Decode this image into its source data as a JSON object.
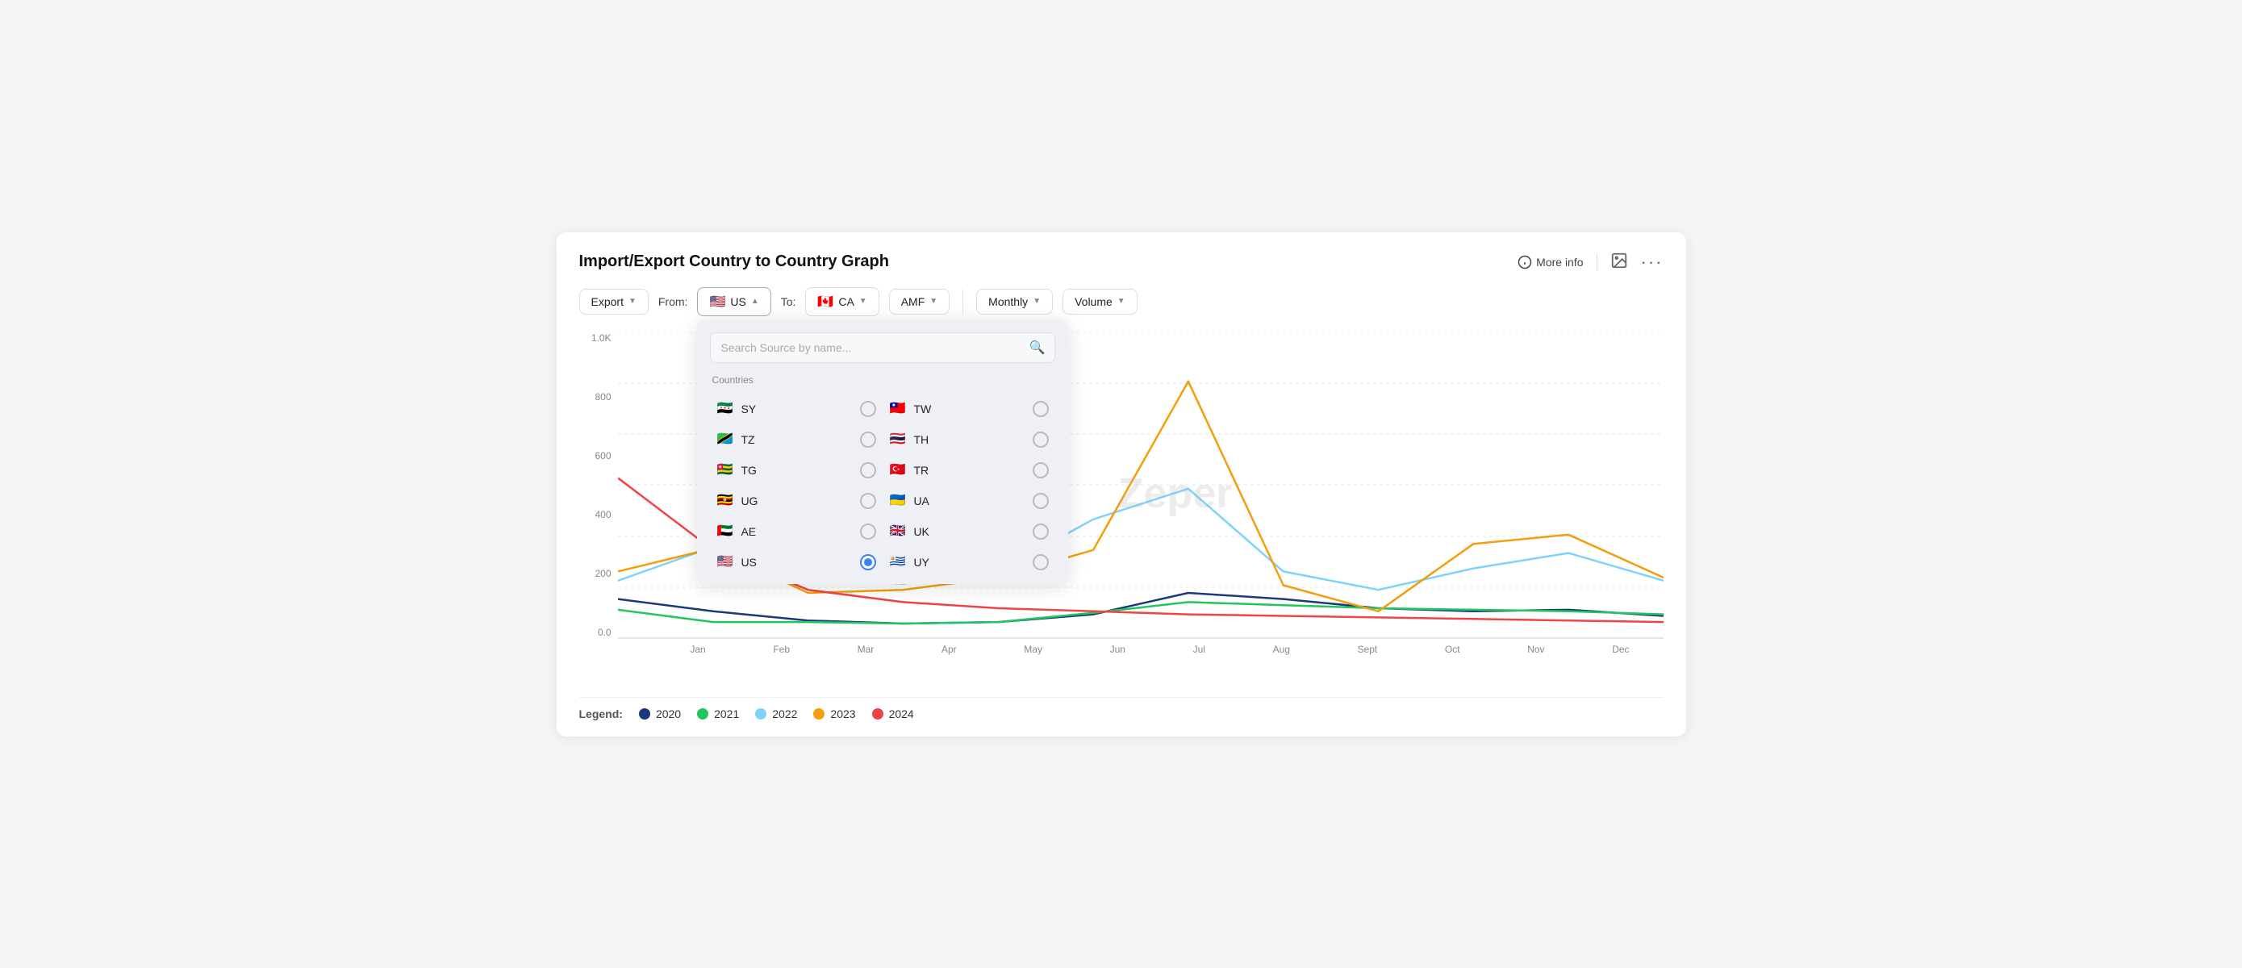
{
  "title": "Import/Export Country to Country Graph",
  "header_actions": {
    "more_info": "More info",
    "image_icon": "image-icon",
    "dots_icon": "more-options-icon"
  },
  "controls": {
    "export_label": "Export",
    "from_label": "From:",
    "from_value": "US",
    "to_label": "To:",
    "to_value": "CA",
    "commodity_value": "AMF",
    "frequency_value": "Monthly",
    "measure_value": "Volume"
  },
  "dropdown": {
    "search_placeholder": "Search Source by name...",
    "section_label": "Countries",
    "countries": [
      {
        "code": "SY",
        "flag": "🇸🇾",
        "selected": false
      },
      {
        "code": "TW",
        "flag": "🇹🇼",
        "selected": false
      },
      {
        "code": "TZ",
        "flag": "🇹🇿",
        "selected": false
      },
      {
        "code": "TH",
        "flag": "🇹🇭",
        "selected": false
      },
      {
        "code": "TG",
        "flag": "🇹🇬",
        "selected": false
      },
      {
        "code": "TR",
        "flag": "🇹🇷",
        "selected": false
      },
      {
        "code": "UG",
        "flag": "🇺🇬",
        "selected": false
      },
      {
        "code": "UA",
        "flag": "🇺🇦",
        "selected": false
      },
      {
        "code": "AE",
        "flag": "🇦🇪",
        "selected": false
      },
      {
        "code": "UK",
        "flag": "🇬🇧",
        "selected": false
      },
      {
        "code": "US",
        "flag": "🇺🇸",
        "selected": true
      },
      {
        "code": "UY",
        "flag": "🇺🇾",
        "selected": false
      }
    ]
  },
  "chart": {
    "y_labels": [
      "1.0K",
      "800",
      "600",
      "400",
      "200",
      "0.0"
    ],
    "x_labels": [
      "Jan",
      "Feb",
      "Mar",
      "Apr",
      "May",
      "Jun",
      "Jul",
      "Aug",
      "Sept",
      "Oct",
      "Nov",
      "Dec"
    ],
    "watermark": "Zeper",
    "series": {
      "2020": {
        "color": "#1a3a7c",
        "points": [
          130,
          90,
          60,
          50,
          55,
          80,
          150,
          130,
          100,
          90,
          95,
          75
        ]
      },
      "2021": {
        "color": "#22c55e",
        "points": [
          95,
          55,
          55,
          50,
          55,
          85,
          120,
          110,
          100,
          95,
          90,
          80
        ]
      },
      "2022": {
        "color": "#7dd3fc",
        "points": [
          190,
          300,
          200,
          180,
          220,
          390,
          490,
          220,
          160,
          230,
          280,
          190
        ]
      },
      "2023": {
        "color": "#f59e0b",
        "points": [
          220,
          295,
          150,
          160,
          200,
          290,
          840,
          175,
          90,
          310,
          340,
          200
        ]
      },
      "2024": {
        "color": "#ef4444",
        "points": [
          525,
          290,
          160,
          120,
          100,
          90,
          80,
          75,
          70,
          65,
          60,
          55
        ]
      }
    }
  },
  "legend": {
    "label": "Legend:",
    "items": [
      {
        "year": "2020",
        "color": "#1a3a7c"
      },
      {
        "year": "2021",
        "color": "#22c55e"
      },
      {
        "year": "2022",
        "color": "#7dd3fc"
      },
      {
        "year": "2023",
        "color": "#f59e0b"
      },
      {
        "year": "2024",
        "color": "#ef4444"
      }
    ]
  }
}
